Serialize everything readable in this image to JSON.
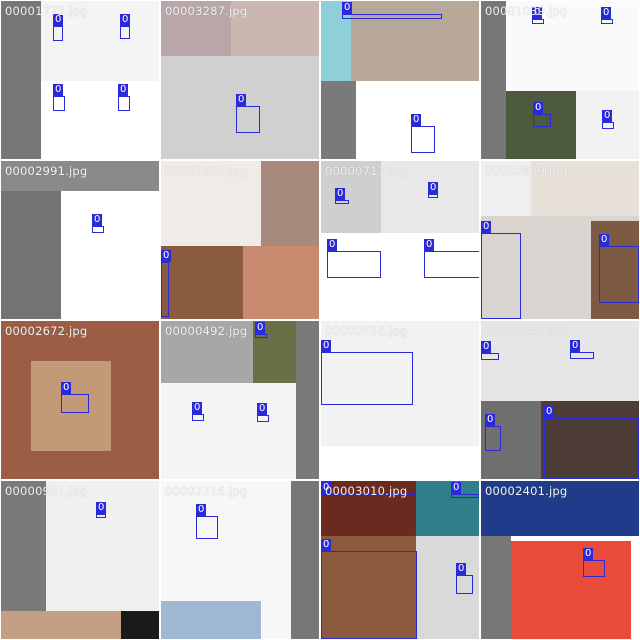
{
  "mosaic": {
    "label_color": "#2a2ad8",
    "tiles": [
      {
        "filename": "00001772.jpg"
      },
      {
        "filename": "00003287.jpg"
      },
      {
        "filename": ""
      },
      {
        "filename": "00001039.jpg"
      },
      {
        "filename": "00002991.jpg"
      },
      {
        "filename": "00001561.jpg"
      },
      {
        "filename": "00000717.jpg"
      },
      {
        "filename": "00000899.jpg"
      },
      {
        "filename": "00002672.jpg"
      },
      {
        "filename": "00000492.jpg"
      },
      {
        "filename": "00000056.jpg"
      },
      {
        "filename": "00001547.jpg"
      },
      {
        "filename": "00000901.jpg"
      },
      {
        "filename": "00002216.jpg"
      },
      {
        "filename": "00003010.jpg"
      },
      {
        "filename": "00002401.jpg"
      }
    ],
    "detections": [
      [
        {
          "label": "0"
        },
        {
          "label": "0"
        },
        {
          "label": "0"
        },
        {
          "label": "0"
        }
      ],
      [
        {
          "label": "0"
        }
      ],
      [
        {
          "label": "0"
        },
        {
          "label": "0"
        }
      ],
      [
        {
          "label": "0"
        },
        {
          "label": "0"
        },
        {
          "label": "0"
        },
        {
          "label": "0"
        }
      ],
      [
        {
          "label": "0"
        },
        {
          "label": "0"
        }
      ],
      [
        {
          "label": "0"
        }
      ],
      [
        {
          "label": "0"
        },
        {
          "label": "0"
        },
        {
          "label": "0"
        },
        {
          "label": "0"
        },
        {
          "label": "0"
        }
      ],
      [
        {
          "label": "0"
        },
        {
          "label": "0"
        }
      ],
      [
        {
          "label": "0"
        }
      ],
      [
        {
          "label": "0"
        },
        {
          "label": "0"
        },
        {
          "label": "0"
        }
      ],
      [
        {
          "label": "0"
        }
      ],
      [
        {
          "label": "0"
        },
        {
          "label": "0"
        },
        {
          "label": "0"
        },
        {
          "label": "0"
        }
      ],
      [
        {
          "label": "0"
        }
      ],
      [
        {
          "label": "0"
        }
      ],
      [
        {
          "label": "0"
        },
        {
          "label": "0"
        },
        {
          "label": "0"
        },
        {
          "label": "0"
        }
      ],
      [
        {
          "label": "0"
        }
      ]
    ]
  }
}
